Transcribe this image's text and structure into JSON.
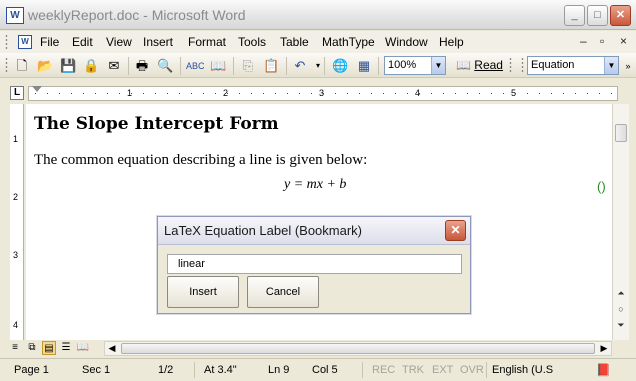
{
  "window": {
    "title": "weeklyReport.doc - Microsoft Word",
    "app_icon": "W"
  },
  "menu": {
    "items": [
      "File",
      "Edit",
      "View",
      "Insert",
      "Format",
      "Tools",
      "Table",
      "MathType",
      "Window",
      "Help"
    ],
    "minimize": "–",
    "restore": "▫",
    "close": "×"
  },
  "toolbar": {
    "zoom": "100%",
    "read_label": "Read",
    "style": "Equation",
    "icons": [
      "new-icon",
      "open-icon",
      "save-icon",
      "permission-icon",
      "email-icon",
      "print-icon",
      "print-preview-icon",
      "spelling-icon",
      "research-icon",
      "copy-icon",
      "paste-icon",
      "undo-icon",
      "hyperlink-icon",
      "tables-borders-icon"
    ]
  },
  "ruler": {
    "numbers": [
      "1",
      "2",
      "3",
      "4",
      "5"
    ],
    "vnumbers": [
      "1",
      "2",
      "3",
      "4"
    ],
    "tab_selector": "L"
  },
  "document": {
    "heading": "The Slope Intercept Form",
    "paragraph": "The common equation describing a line is given below:",
    "equation": "y = mx + b",
    "marker": "()"
  },
  "dialog": {
    "title": "LaTeX Equation Label (Bookmark)",
    "input_value": "linear",
    "insert_label": "Insert",
    "cancel_label": "Cancel"
  },
  "status": {
    "page": "Page  1",
    "sec": "Sec  1",
    "pages": "1/2",
    "at": "At 3.4\"",
    "ln": "Ln  9",
    "col": "Col  5",
    "rec": "REC",
    "trk": "TRK",
    "ext": "EXT",
    "ovr": "OVR",
    "language": "English (U.S"
  }
}
